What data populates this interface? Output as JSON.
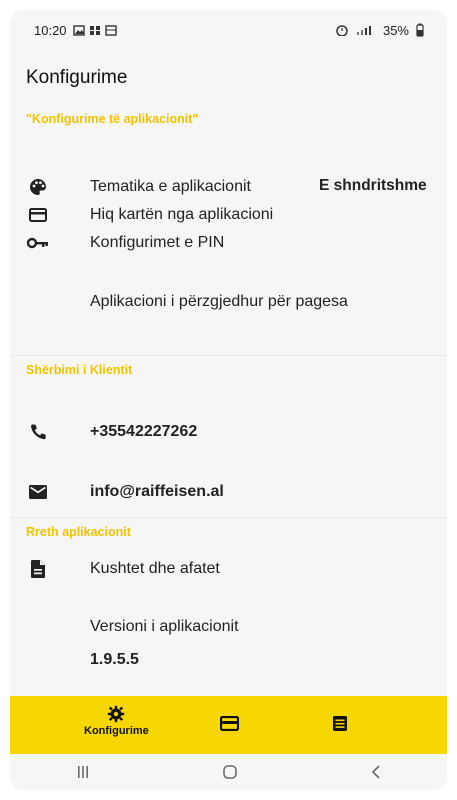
{
  "status_bar": {
    "time": "10:20",
    "battery": "35%"
  },
  "header": {
    "title": "Konfigurime"
  },
  "sections": {
    "app_settings": "\"Konfigurime të aplikacionit\"",
    "customer_service": "Shërbimi i Klientit",
    "about": "Rreth aplikacionit"
  },
  "settings": {
    "theme_label": "Tematika e aplikacionit",
    "theme_value": "E shndritshme",
    "remove_card_label": "Hiq kartën nga aplikacioni",
    "pin_label": "Konfigurimet e PIN",
    "payment_app_label": "Aplikacioni i përzgjedhur për pagesa"
  },
  "customer_service": {
    "phone": "+35542227262",
    "email": "info@raiffeisen.al"
  },
  "about": {
    "terms_label": "Kushtet dhe afatet",
    "version_label": "Versioni i aplikacionit",
    "version_value": "1.9.5.5"
  },
  "bottom_nav": {
    "settings_label": "Konfigurime"
  },
  "colors": {
    "accent": "#F6D800",
    "section_text": "#F3C300"
  },
  "icons": [
    "palette-icon",
    "card-icon",
    "key-icon",
    "phone-icon",
    "mail-icon",
    "document-icon",
    "gear-icon",
    "card-nav-icon",
    "list-nav-icon"
  ]
}
